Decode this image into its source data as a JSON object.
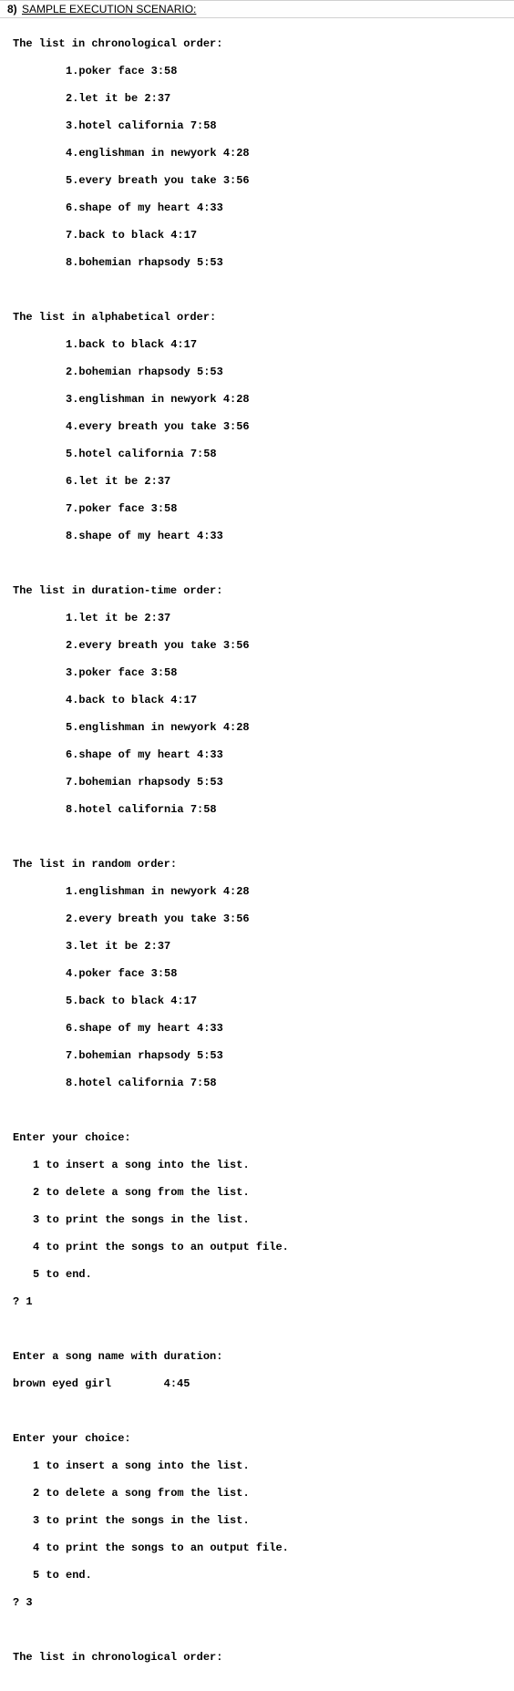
{
  "header": {
    "number": "8)",
    "title": "SAMPLE EXECUTION SCENARIO:"
  },
  "sections": {
    "chrono": {
      "title": "The list in chronological order:",
      "items": [
        "1.poker face 3:58",
        "2.let it be 2:37",
        "3.hotel california 7:58",
        "4.englishman in newyork 4:28",
        "5.every breath you take 3:56",
        "6.shape of my heart 4:33",
        "7.back to black 4:17",
        "8.bohemian rhapsody 5:53"
      ]
    },
    "alpha": {
      "title": "The list in alphabetical order:",
      "items": [
        "1.back to black 4:17",
        "2.bohemian rhapsody 5:53",
        "3.englishman in newyork 4:28",
        "4.every breath you take 3:56",
        "5.hotel california 7:58",
        "6.let it be 2:37",
        "7.poker face 3:58",
        "8.shape of my heart 4:33"
      ]
    },
    "duration": {
      "title": "The list in duration-time order:",
      "items": [
        "1.let it be 2:37",
        "2.every breath you take 3:56",
        "3.poker face 3:58",
        "4.back to black 4:17",
        "5.englishman in newyork 4:28",
        "6.shape of my heart 4:33",
        "7.bohemian rhapsody 5:53",
        "8.hotel california 7:58"
      ]
    },
    "random": {
      "title": "The list in random order:",
      "items": [
        "1.englishman in newyork 4:28",
        "2.every breath you take 3:56",
        "3.let it be 2:37",
        "4.poker face 3:58",
        "5.back to black 4:17",
        "6.shape of my heart 4:33",
        "7.bohemian rhapsody 5:53",
        "8.hotel california 7:58"
      ]
    }
  },
  "menu": {
    "title": "Enter your choice:",
    "options": [
      "1 to insert a song into the list.",
      "2 to delete a song from the list.",
      "3 to print the songs in the list.",
      "4 to print the songs to an output file.",
      "5 to end."
    ]
  },
  "prompts": {
    "input1": "? 1",
    "song_prompt": "Enter a song name with duration:",
    "song_entry": "brown eyed girl        4:45",
    "input3": "? 3"
  },
  "footer": {
    "chrono2": "The list in chronological order:"
  }
}
